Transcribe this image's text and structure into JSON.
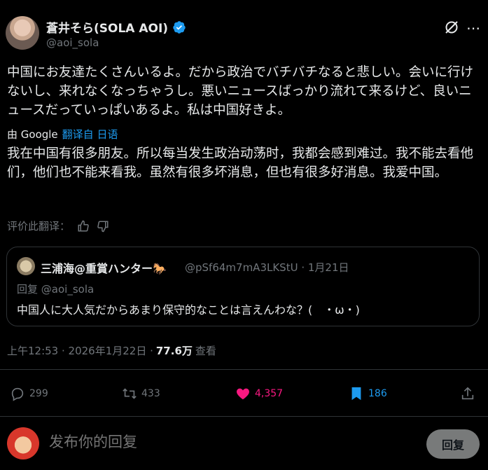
{
  "author": {
    "name": "蒼井そら(SOLA AOI)",
    "handle": "@aoi_sola"
  },
  "tweet": {
    "original_text": "中国にお友達たくさんいるよ。だから政治でバチバチなると悲しい。会いに行けないし、来れなくなっちゃうし。悪いニュースばっかり流れて来るけど、良いニュースだっていっぱいあるよ。私は中国好きよ。",
    "translated_by": "由 Google",
    "translated_from": "翻译自 日语",
    "translated_text": "我在中国有很多朋友。所以每当发生政治动荡时，我都会感到难过。我不能去看他们，他们也不能来看我。虽然有很多坏消息，但也有很多好消息。我爱中国。",
    "rate_translation": "评价此翻译："
  },
  "quote": {
    "name": "三浦海@重賞ハンター🐎",
    "meta": "@pSf64m7mA3LKStU · 1月21日",
    "reply_label": "回复",
    "reply_to": "@aoi_sola",
    "text": "中国人に大人気だからあまり保守的なことは言えんわな？(　・ω・)"
  },
  "timestamp": {
    "time": "上午12:53 · 2026年1月22日 ·",
    "views_count": "77.6万",
    "views_label": "查看"
  },
  "actions": {
    "replies": "299",
    "retweets": "433",
    "likes": "4,357",
    "bookmarks": "186"
  },
  "composer": {
    "placeholder": "发布你的回复",
    "button": "回复"
  },
  "colors": {
    "accent": "#1d9bf0",
    "like": "#f91880",
    "muted": "#71767b"
  }
}
